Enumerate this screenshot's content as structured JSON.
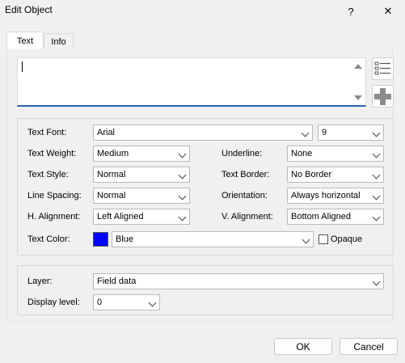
{
  "window": {
    "title": "Edit Object",
    "help_glyph": "?",
    "close_glyph": "✕"
  },
  "tabs": [
    {
      "label": "Text",
      "active": true
    },
    {
      "label": "Info",
      "active": false
    }
  ],
  "text_area": {
    "value": ""
  },
  "side_icons": [
    "list-icon",
    "add-icon"
  ],
  "font_group": {
    "text_font": {
      "label": "Text Font:",
      "value": "Arial"
    },
    "font_size": {
      "value": "9"
    },
    "text_weight": {
      "label": "Text Weight:",
      "value": "Medium"
    },
    "underline": {
      "label": "Underline:",
      "value": "None"
    },
    "text_style": {
      "label": "Text Style:",
      "value": "Normal"
    },
    "text_border": {
      "label": "Text Border:",
      "value": "No Border"
    },
    "line_spacing": {
      "label": "Line Spacing:",
      "value": "Normal"
    },
    "orientation": {
      "label": "Orientation:",
      "value": "Always horizontal"
    },
    "h_alignment": {
      "label": "H. Alignment:",
      "value": "Left Aligned"
    },
    "v_alignment": {
      "label": "V. Alignment:",
      "value": "Bottom Aligned"
    },
    "text_color": {
      "label": "Text Color:",
      "value": "Blue",
      "swatch": "#0000ff"
    },
    "opaque": {
      "label": "Opaque",
      "checked": false
    }
  },
  "layer_group": {
    "layer": {
      "label": "Layer:",
      "value": "Field data"
    },
    "display_level": {
      "label": "Display level:",
      "value": "0"
    }
  },
  "buttons": {
    "ok": "OK",
    "cancel": "Cancel"
  }
}
